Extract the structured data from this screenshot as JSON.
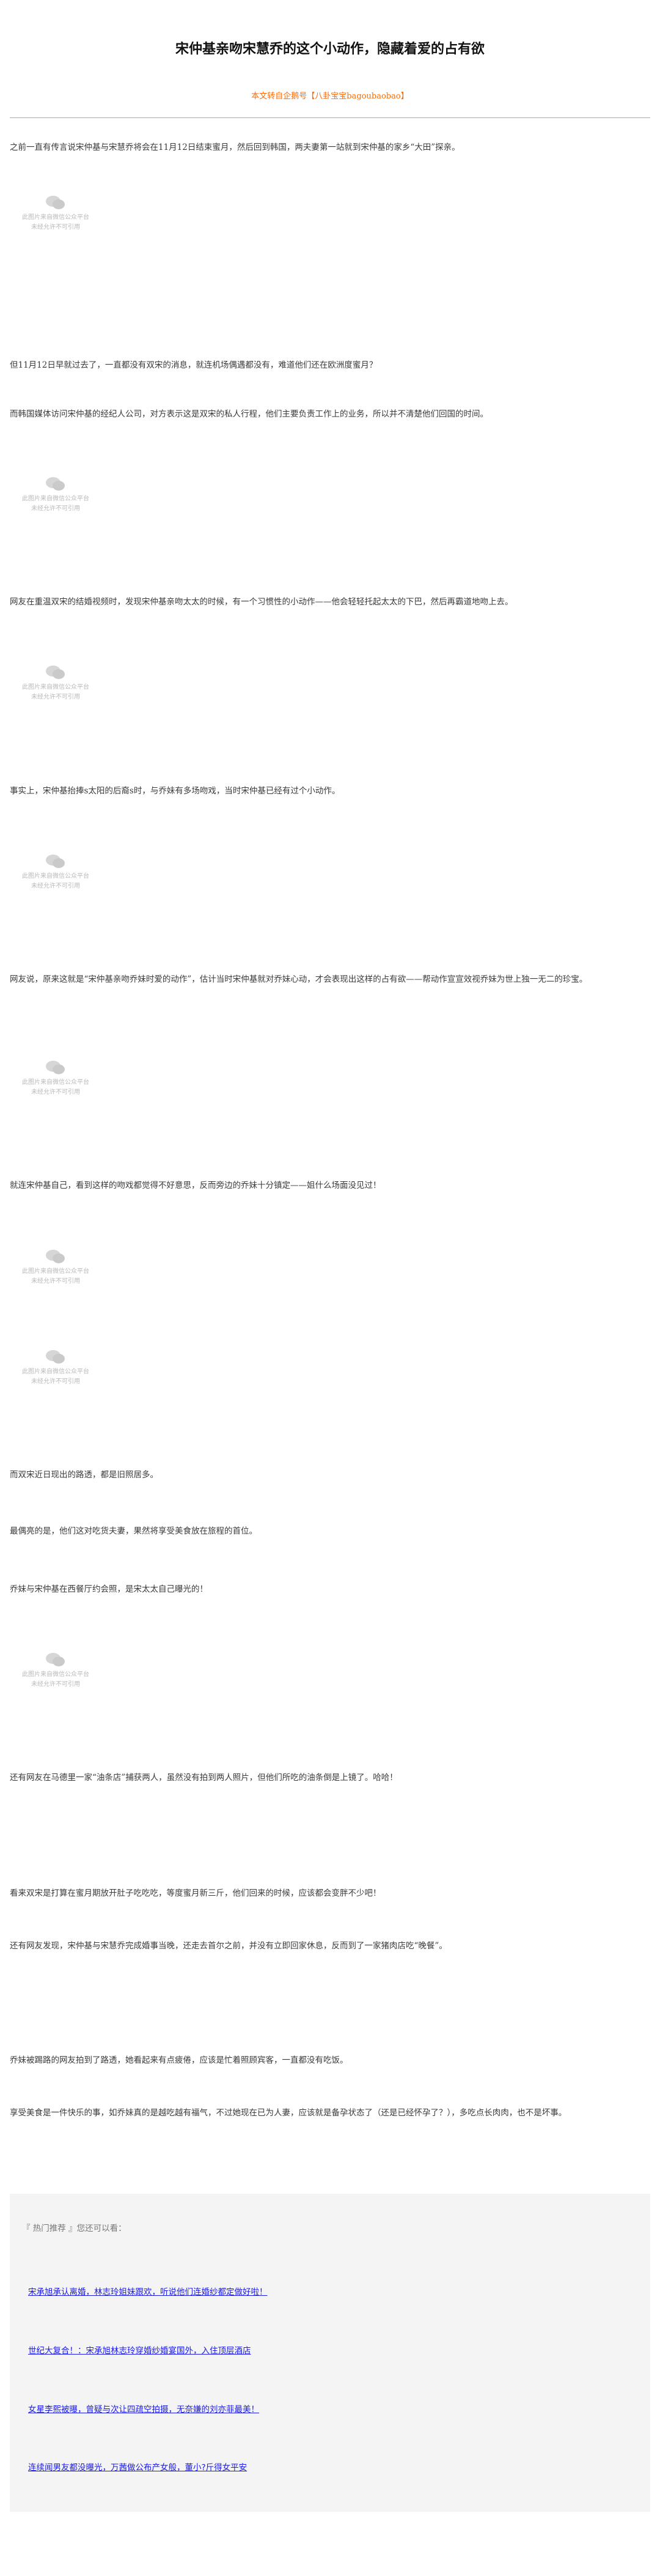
{
  "article": {
    "title": "宋仲基亲吻宋慧乔的这个小动作，隐藏着爱的占有欲",
    "source_prefix": "本文转自企鹅号【",
    "source_name": "八卦宝宝",
    "source_handle": "bagoubaobao",
    "source_suffix": "】"
  },
  "image_placeholder": {
    "line1": "此图片来自微信公众平台",
    "line2": "未经允许不可引用"
  },
  "paragraphs": [
    "之前一直有传言说宋仲基与宋慧乔将会在11月12日结束蜜月，然后回到韩国，两夫妻第一站就到宋仲基的家乡“大田”探亲。",
    "但11月12日早就过去了，一直都没有双宋的消息，就连机场偶遇都没有，难道他们还在欧洲度蜜月？",
    "而韩国媒体访问宋仲基的经纪人公司，对方表示这是双宋的私人行程，他们主要负责工作上的业务，所以并不清楚他们回国的时间。",
    "网友在重温双宋的结婚视频时，发现宋仲基亲吻太太的时候，有一个习惯性的小动作——他会轻轻托起太太的下巴，然后再霸道地吻上去。",
    "事实上，宋仲基抬捧s太阳的后裔s时，与乔妹有多场吻戏，当时宋仲基已经有过个小动作。",
    "网友说，原来这就是“宋仲基亲吻乔妹时爱的动作”，估计当时宋仲基就对乔妹心动，才会表现出这样的占有欲——帮动作宣宣效视乔妹为世上独一无二的珍宝。",
    "就连宋仲基自己，看到这样的吻戏都觉得不好意思，反而旁边的乔妹十分镇定——姐什么场面没见过！",
    "而双宋近日现出的路透，都是旧照居多。",
    "最偶亮的是，他们这对吃货夫妻，果然将享受美食放在旅程的首位。",
    "乔妹与宋仲基在西餐厅约会照，是宋太太自己曝光的！",
    "还有网友在马德里一家“油条店”捕获两人，虽然没有拍到两人照片，但他们所吃的油条倒是上镜了。哈哈！",
    "看来双宋是打算在蜜月期放开肚子吃吃吃，等度蜜月新三斤，他们回来的时候，应该都会变胖不少吧！",
    "还有网友发现，宋仲基与宋慧乔完成婚事当晚，还走去首尔之前，并没有立即回家休息，反而到了一家猪肉店吃“晚餐”。",
    "乔妹被踢路的网友拍到了路透，她看起来有点疲倦，应该是忙着照顾宾客，一直都没有吃饭。",
    "享受美食是一件快乐的事，如乔妹真的是越吃越有福气，不过她现在已为人妻，应该就是备孕状态了（还是已经怀孕了？），多吃点长肉肉，也不是坏事。"
  ],
  "hot": {
    "title": "『 热门推荐 』您还可以看：",
    "links": [
      "宋承旭承认离婚，林志玲姐妹跟欢，听说他们连婚纱都定做好啦！",
      "世纪大复合！：宋承旭林志玲穿婚纱婚宴国外，入住顶层酒店",
      "女星李熙被曝，曾疑与次让四疏空拍摄，无奈嫌的刘亦菲最美！",
      "连续闻男友都没曝光，万茜做公布产女般，董小?斤得女平安"
    ]
  }
}
